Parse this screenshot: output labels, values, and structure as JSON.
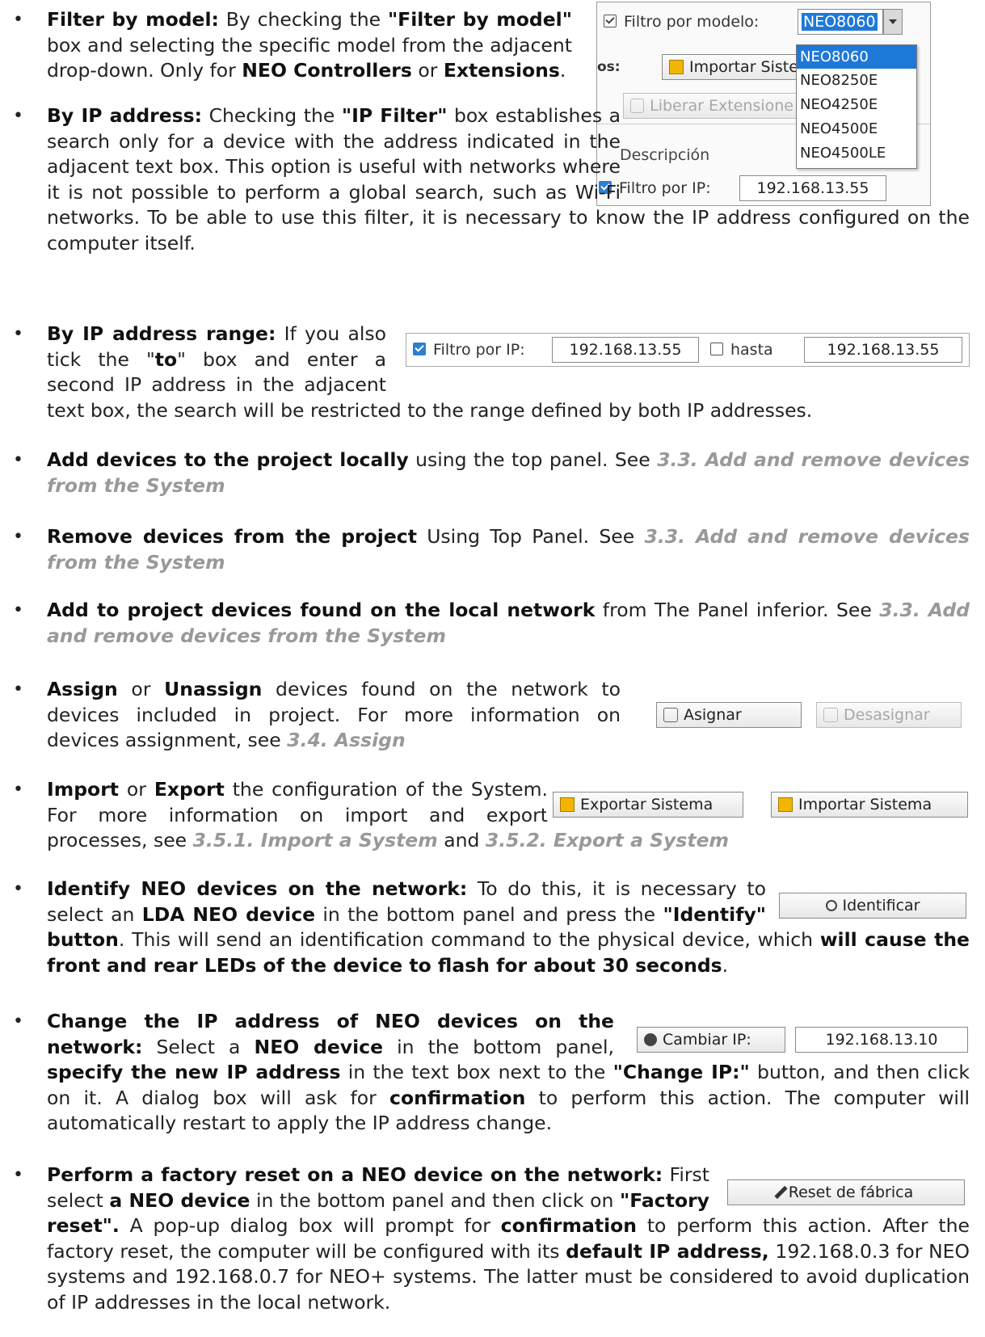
{
  "bullet_char": "•",
  "items": [
    {
      "lead": "Filter by model:",
      "p1": " By checking the ",
      "b1": "\"Filter by model\"",
      "p2": " box and selecting the specific model from the adjacent drop-down. Only for ",
      "b2": "NEO Controllers",
      "p3": " or ",
      "b3": "Extensions",
      "p4": "."
    },
    {
      "lead": "By IP address:",
      "p1": " Checking the ",
      "b1": "\"IP Filter\"",
      "p2": " box establishes a search only for a device with the address indicated in the adjacent text box. This option is useful with networks where it is not possible to perform a global search, such as Wi-Fi networks. To be able to use this filter, it is necessary to know the IP address configured on the computer itself."
    },
    {
      "lead": "By IP address range:",
      "p1": " If you also tick the \"",
      "b1": "to",
      "p2": "\" box and enter a second IP address in the adjacent text box, the search will be restricted to the range defined by both IP addresses."
    },
    {
      "lead": "Add devices to the project locally",
      "p1": " using the top panel. See ",
      "ref": "3.3. Add and remove devices from the System"
    },
    {
      "lead": "Remove devices from the project",
      "p1": " Using Top Panel. See ",
      "ref": "3.3. Add and remove devices from the System"
    },
    {
      "lead": "Add to project devices found on the local network",
      "p1": " from The Panel inferior. See ",
      "ref": "3.3. Add and remove devices from the System"
    },
    {
      "lead": "Assign",
      "p1": " or ",
      "b1": "Unassign",
      "p2": " devices found on the network to devices included in project. For more information on devices assignment, see ",
      "ref": "3.4. Assign"
    },
    {
      "lead": "Import",
      "p1": " or ",
      "b1": "Export",
      "p2": " the configuration of the System. For more information on import and export processes, see ",
      "ref1": "3.5.1. Import a System",
      "p3": " and ",
      "ref2": "3.5.2. Export a System"
    },
    {
      "lead": "Identify NEO devices on the network:",
      "p1": " To do this, it is necessary to select an ",
      "b1": "LDA NEO device",
      "p2": " in the bottom panel and press the ",
      "b2": "\"Identify\" button",
      "p3": ". This will send an identification command to the physical device, which ",
      "b3": "will cause the front and rear LEDs of the device to flash for about 30 seconds",
      "p4": "."
    },
    {
      "lead": "Change the IP address of NEO devices on the network:",
      "p1": " Select a ",
      "b1": "NEO device",
      "p2": " in the bottom panel, ",
      "b2": "specify the new IP address",
      "p3": " in the text box next to the ",
      "b3": "\"Change IP:\"",
      "p4": " button, and then click on it.  A dialog box will ask for ",
      "b4": "confirmation",
      "p5": " to perform this action. The computer will automatically restart to apply the IP address change."
    },
    {
      "lead": "Perform a factory reset on a NEO device on the network:",
      "p1": " First select ",
      "b1": "a NEO device",
      "p2": " in the bottom panel and then click on ",
      "b2": "\"Factory reset\".",
      "p3": " A pop-up dialog box will prompt for ",
      "b3": "confirmation",
      "p4": " to perform this action. After the factory reset, the computer will be configured with its ",
      "b4": "default IP address,",
      "p5": " 192.168.0.3 for NEO systems and 192.168.0.7 for NEO+ systems. The latter must be considered to avoid duplication of IP addresses in the local network."
    }
  ],
  "ui": {
    "model_filter_label": "Filtro por modelo:",
    "model_selected": "NEO8060",
    "model_options": [
      "NEO8060",
      "NEO8250E",
      "NEO4250E",
      "NEO4500E",
      "NEO4500LE"
    ],
    "partial_label": "os:",
    "import_system_partial": "Importar Siste",
    "release_extensions_partial": "Liberar Extensione",
    "description_header": "Descripción",
    "ip_filter_label": "Filtro por IP:",
    "ip_filter_value": "192.168.13.55",
    "to_label": "hasta",
    "to_value": "192.168.13.55",
    "assign_label": "Asignar",
    "unassign_label": "Desasignar",
    "export_label": "Exportar Sistema",
    "import_label": "Importar Sistema",
    "identify_label": "Identificar",
    "change_ip_label": "Cambiar IP:",
    "change_ip_value": "192.168.13.10",
    "factory_reset_label": "Reset de fábrica",
    "colors": {
      "accent": "#2d7fd3",
      "highlight": "#1e78d7",
      "ref": "#999999"
    }
  }
}
